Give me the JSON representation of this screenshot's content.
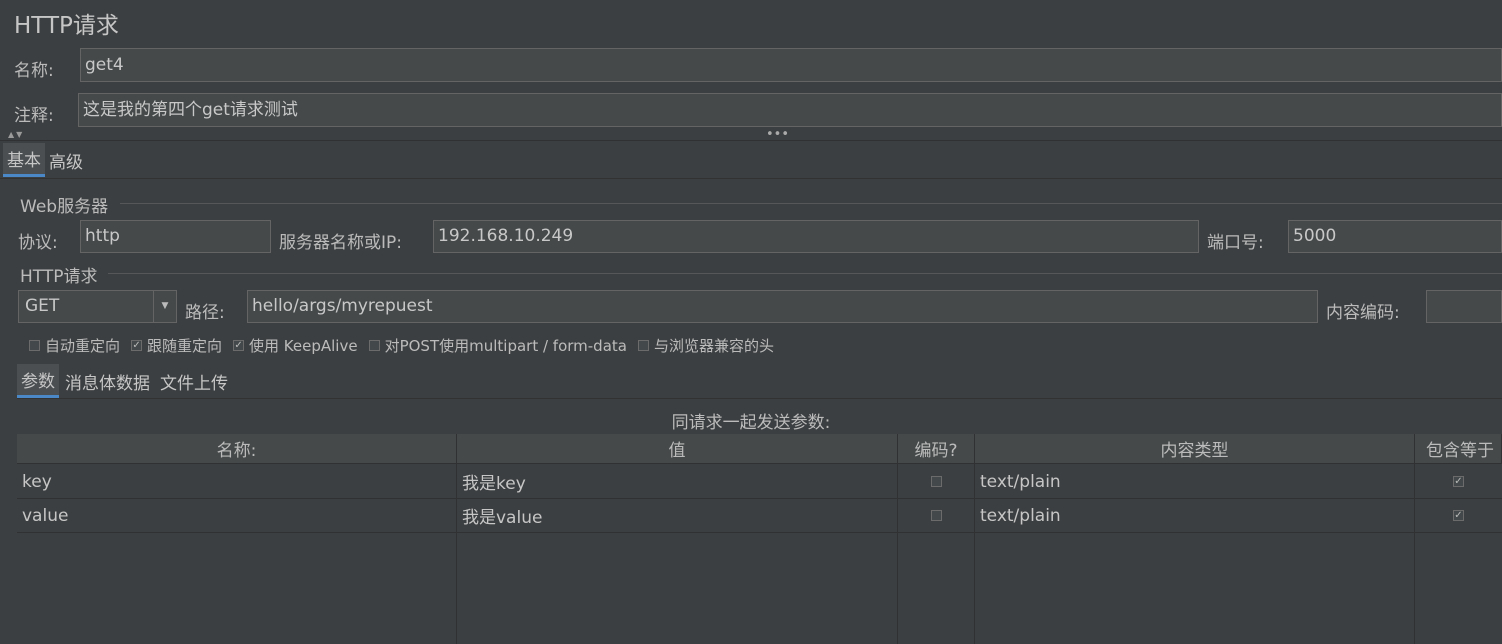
{
  "header": {
    "title": "HTTP请求"
  },
  "name_field": {
    "label": "名称:",
    "value": "get4"
  },
  "comment_field": {
    "label": "注释:",
    "value": "这是我的第四个get请求测试"
  },
  "splitter": {
    "arrows": "▲▼",
    "dots": "•••"
  },
  "main_tabs": [
    {
      "label": "基本",
      "selected": true
    },
    {
      "label": "高级",
      "selected": false
    }
  ],
  "web_server": {
    "title": "Web服务器",
    "protocol_label": "协议:",
    "protocol_value": "http",
    "server_label": "服务器名称或IP:",
    "server_value": "192.168.10.249",
    "port_label": "端口号:",
    "port_value": "5000"
  },
  "http_request": {
    "title": "HTTP请求",
    "method": "GET",
    "path_label": "路径:",
    "path_value": "hello/args/myrepuest",
    "encoding_label": "内容编码:",
    "encoding_value": ""
  },
  "options": [
    {
      "label": "自动重定向",
      "checked": false
    },
    {
      "label": "跟随重定向",
      "checked": true
    },
    {
      "label": "使用 KeepAlive",
      "checked": true
    },
    {
      "label": "对POST使用multipart / form-data",
      "checked": false
    },
    {
      "label": "与浏览器兼容的头",
      "checked": false
    }
  ],
  "sub_tabs": [
    {
      "label": "参数",
      "selected": true
    },
    {
      "label": "消息体数据",
      "selected": false
    },
    {
      "label": "文件上传",
      "selected": false
    }
  ],
  "params": {
    "caption": "同请求一起发送参数:",
    "columns": [
      "名称:",
      "值",
      "编码?",
      "内容类型",
      "包含等于"
    ],
    "rows": [
      {
        "name": "key",
        "value": "我是key",
        "encode": false,
        "content_type": "text/plain",
        "include_equals": true
      },
      {
        "name": "value",
        "value": "我是value",
        "encode": false,
        "content_type": "text/plain",
        "include_equals": true
      }
    ]
  },
  "colors": {
    "background": "#3c3f41",
    "field": "#45494a",
    "accent": "#4a88c7"
  }
}
